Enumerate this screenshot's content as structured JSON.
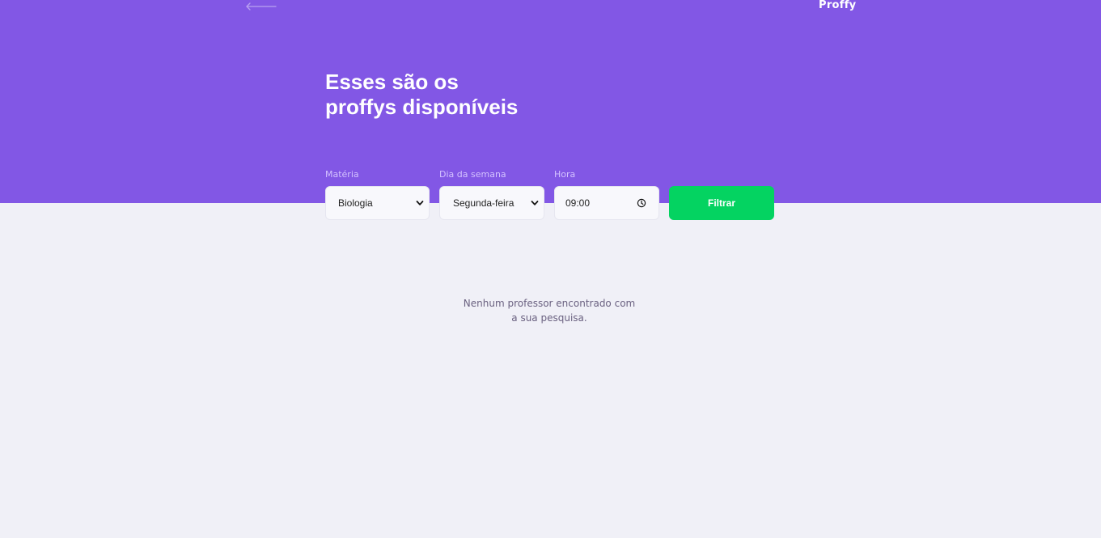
{
  "header": {
    "back_icon": "arrow-left-icon",
    "logo_text": "Proffy",
    "title_lines": [
      "Esses são os",
      "proffys disponíveis"
    ]
  },
  "filters": {
    "subject": {
      "label": "Matéria",
      "value": "Biologia",
      "icon": "chevron-down-icon"
    },
    "weekday": {
      "label": "Dia da semana",
      "value": "Segunda-feira",
      "icon": "chevron-down-icon"
    },
    "time": {
      "label": "Hora",
      "value": "09:00",
      "icon": "clock-icon"
    },
    "submit_label": "Filtrar"
  },
  "results": {
    "empty_lines": [
      "Nenhum professor encontrado com",
      "a sua pesquisa."
    ]
  },
  "colors": {
    "primary": "#8257E5",
    "secondary": "#04D361",
    "background": "#F0F0F7",
    "label_on_primary": "#D4C2FF",
    "text_muted": "#6A6180"
  }
}
